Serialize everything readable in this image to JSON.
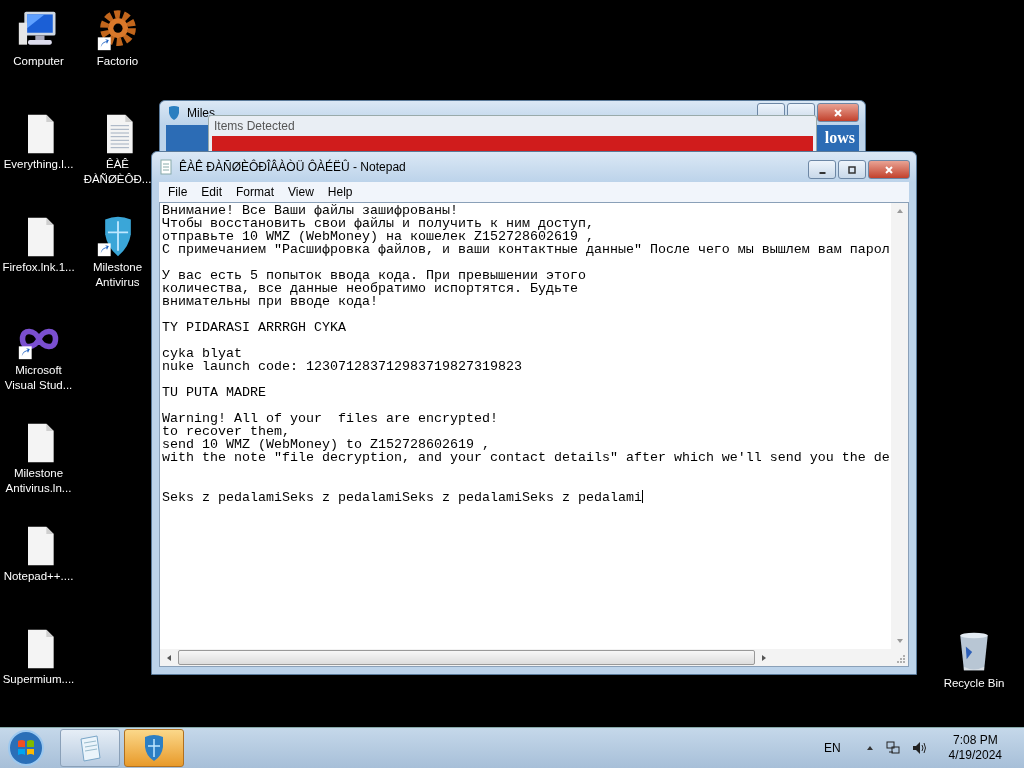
{
  "desktop": {
    "columns": [
      [
        {
          "label": "Computer",
          "kind": "computer",
          "shortcut": false
        },
        {
          "label": "Everything.l...",
          "kind": "file",
          "shortcut": false
        },
        {
          "label": "Firefox.lnk.1...",
          "kind": "file",
          "shortcut": false
        },
        {
          "label": "Microsoft Visual Stud...",
          "kind": "infinity",
          "shortcut": true
        },
        {
          "label": "Milestone Antivirus.ln...",
          "kind": "file",
          "shortcut": false
        },
        {
          "label": "Notepad++....",
          "kind": "file",
          "shortcut": false
        },
        {
          "label": "Supermium....",
          "kind": "file",
          "shortcut": false
        }
      ],
      [
        {
          "label": "Factorio",
          "kind": "gear",
          "shortcut": true
        },
        {
          "label": "ÊÀÊ ÐÀÑØÈÔÐ...",
          "kind": "textfile",
          "shortcut": false
        },
        {
          "label": "Milestone Antivirus",
          "kind": "shield",
          "shortcut": true
        }
      ]
    ],
    "recycle_bin": {
      "label": "Recycle Bin"
    }
  },
  "back_window": {
    "title": "Miles",
    "banner_text": "lows"
  },
  "alert_window": {
    "title": "Items Detected"
  },
  "notepad": {
    "title": "ÊÀÊ ÐÀÑØÈÔÐÎÂÀÒÜ ÔÀÉËÛ - Notepad",
    "menu": [
      "File",
      "Edit",
      "Format",
      "View",
      "Help"
    ],
    "text": "Внимание! Все Ваши файлы зашифрованы!\nЧтобы восстановить свои файлы и получить к ним доступ,\nотправьте 10 WMZ (WebMoney) на кошелек Z152728602619 ,\nС примечанием \"Расшифровка файлов, и ваши контактные данные\" После чего мы вышлем вам парол\n\nУ вас есть 5 попыток ввода кода. При превышении этого\nколичества, все данные необратимо испортятся. Будьте\nвнимательны при вводе кода!\n\nTY PIDARASI ARRRGH CYKA\n\ncyka blyat\nnuke launch code: 123071283712983719827319823\n\nTU PUTA MADRE\n\nWarning! All of your  files are encrypted!\nto recover them,\nsend 10 WMZ (WebMoney) to Z152728602619 ,\nwith the note \"file decryption, and your contact details\" after which we'll send you the de\n\n\nSeks z pedalamiSeks z pedalamiSeks z pedalamiSeks z pedalami"
  },
  "taskbar": {
    "buttons": [
      {
        "kind": "notepad",
        "selected": false
      },
      {
        "kind": "antivirus",
        "selected": true
      }
    ],
    "language": "EN",
    "time": "7:08 PM",
    "date": "4/19/2024"
  }
}
